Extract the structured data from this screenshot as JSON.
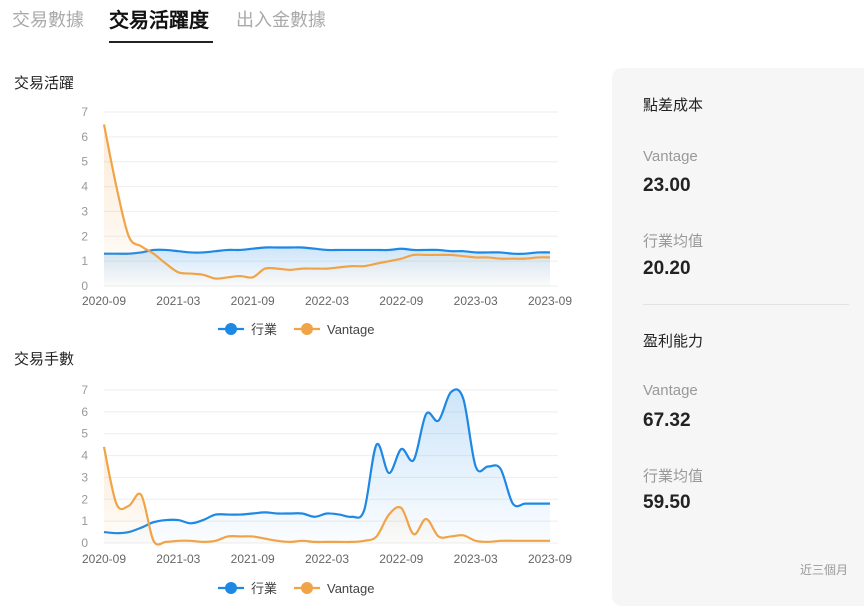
{
  "tabs": [
    {
      "label": "交易數據",
      "active": false
    },
    {
      "label": "交易活躍度",
      "active": true
    },
    {
      "label": "出入金數據",
      "active": false
    }
  ],
  "legend": {
    "industry": "行業",
    "vantage": "Vantage"
  },
  "colors": {
    "industry": "#1e88e5",
    "vantage": "#f0a447",
    "grid": "#eeeeee",
    "axis": "#999999"
  },
  "chart_data": [
    {
      "type": "line",
      "title": "交易活躍",
      "ylim": [
        0,
        7
      ],
      "yticks": [
        0,
        1,
        2,
        3,
        4,
        5,
        6,
        7
      ],
      "xticks": [
        "2020-09",
        "2021-03",
        "2021-09",
        "2022-03",
        "2022-09",
        "2023-03",
        "2023-09"
      ],
      "x_months": [
        0,
        1,
        2,
        3,
        4,
        5,
        6,
        7,
        8,
        9,
        10,
        11,
        12,
        13,
        14,
        15,
        16,
        17,
        18,
        19,
        20,
        21,
        22,
        23,
        24,
        25,
        26,
        27,
        28,
        29,
        30,
        31,
        32,
        33,
        34,
        35,
        36
      ],
      "series": [
        {
          "name": "行業",
          "values": [
            1.3,
            1.3,
            1.3,
            1.35,
            1.45,
            1.45,
            1.4,
            1.35,
            1.35,
            1.4,
            1.45,
            1.45,
            1.5,
            1.55,
            1.55,
            1.55,
            1.55,
            1.5,
            1.45,
            1.45,
            1.45,
            1.45,
            1.45,
            1.45,
            1.5,
            1.45,
            1.45,
            1.45,
            1.4,
            1.4,
            1.35,
            1.35,
            1.35,
            1.3,
            1.3,
            1.35,
            1.35
          ]
        },
        {
          "name": "Vantage",
          "values": [
            6.5,
            4.0,
            2.0,
            1.6,
            1.3,
            0.9,
            0.55,
            0.5,
            0.45,
            0.3,
            0.35,
            0.4,
            0.35,
            0.7,
            0.7,
            0.65,
            0.7,
            0.7,
            0.7,
            0.75,
            0.8,
            0.8,
            0.9,
            1.0,
            1.1,
            1.25,
            1.25,
            1.25,
            1.25,
            1.2,
            1.15,
            1.15,
            1.1,
            1.1,
            1.1,
            1.15,
            1.15
          ]
        }
      ]
    },
    {
      "type": "line",
      "title": "交易手數",
      "ylim": [
        0,
        7
      ],
      "yticks": [
        0,
        1,
        2,
        3,
        4,
        5,
        6,
        7
      ],
      "xticks": [
        "2020-09",
        "2021-03",
        "2021-09",
        "2022-03",
        "2022-09",
        "2023-03",
        "2023-09"
      ],
      "x_months": [
        0,
        1,
        2,
        3,
        4,
        5,
        6,
        7,
        8,
        9,
        10,
        11,
        12,
        13,
        14,
        15,
        16,
        17,
        18,
        19,
        20,
        21,
        22,
        23,
        24,
        25,
        26,
        27,
        28,
        29,
        30,
        31,
        32,
        33,
        34,
        35,
        36
      ],
      "series": [
        {
          "name": "行業",
          "values": [
            0.5,
            0.45,
            0.5,
            0.7,
            0.95,
            1.05,
            1.05,
            0.9,
            1.05,
            1.3,
            1.3,
            1.3,
            1.35,
            1.4,
            1.35,
            1.35,
            1.35,
            1.2,
            1.35,
            1.3,
            1.2,
            1.5,
            4.5,
            3.2,
            4.3,
            3.8,
            5.9,
            5.6,
            6.9,
            6.6,
            3.5,
            3.5,
            3.4,
            1.8,
            1.8,
            1.8,
            1.8
          ]
        },
        {
          "name": "Vantage",
          "values": [
            4.4,
            1.8,
            1.7,
            2.2,
            0.1,
            0.05,
            0.1,
            0.1,
            0.05,
            0.1,
            0.3,
            0.3,
            0.3,
            0.2,
            0.1,
            0.05,
            0.1,
            0.05,
            0.05,
            0.05,
            0.05,
            0.1,
            0.3,
            1.3,
            1.6,
            0.4,
            1.1,
            0.3,
            0.3,
            0.35,
            0.1,
            0.05,
            0.1,
            0.1,
            0.1,
            0.1,
            0.1
          ]
        }
      ]
    }
  ],
  "panel": {
    "spread_title": "點差成本",
    "spread_vantage_label": "Vantage",
    "spread_vantage_value": "23.00",
    "spread_industry_label": "行業均值",
    "spread_industry_value": "20.20",
    "profit_title": "盈利能力",
    "profit_vantage_label": "Vantage",
    "profit_vantage_value": "67.32",
    "profit_industry_label": "行業均值",
    "profit_industry_value": "59.50",
    "footnote": "近三個月"
  }
}
